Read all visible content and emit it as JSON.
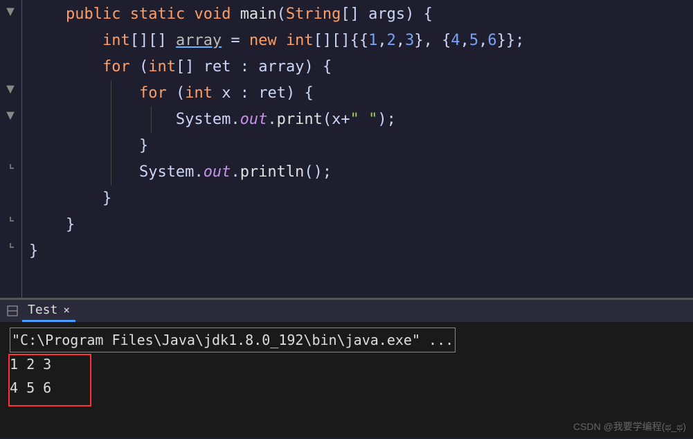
{
  "code": {
    "line1": {
      "kw_public": "public",
      "kw_static": "static",
      "kw_void": "void",
      "method": "main",
      "param_type": "String",
      "param_name": "args"
    },
    "line2": {
      "type": "int",
      "var": "array",
      "eq": " = ",
      "kw_new": "new",
      "type2": "int",
      "n1": "1",
      "n2": "2",
      "n3": "3",
      "n4": "4",
      "n5": "5",
      "n6": "6"
    },
    "line3": {
      "kw_for": "for",
      "type": "int",
      "var": "ret",
      "in": "array"
    },
    "line4": {
      "kw_for": "for",
      "type": "int",
      "var": "x",
      "in": "ret"
    },
    "line5": {
      "obj": "System",
      "field": "out",
      "method": "print",
      "arg": "x",
      "str": "\" \""
    },
    "line7": {
      "obj": "System",
      "field": "out",
      "method": "println"
    }
  },
  "panel": {
    "tab_name": "Test",
    "cmd": "\"C:\\Program Files\\Java\\jdk1.8.0_192\\bin\\java.exe\" ...",
    "out1": "1 2 3",
    "out2": "4 5 6"
  },
  "watermark": "CSDN @我要学编程(ಥ_ಥ)"
}
